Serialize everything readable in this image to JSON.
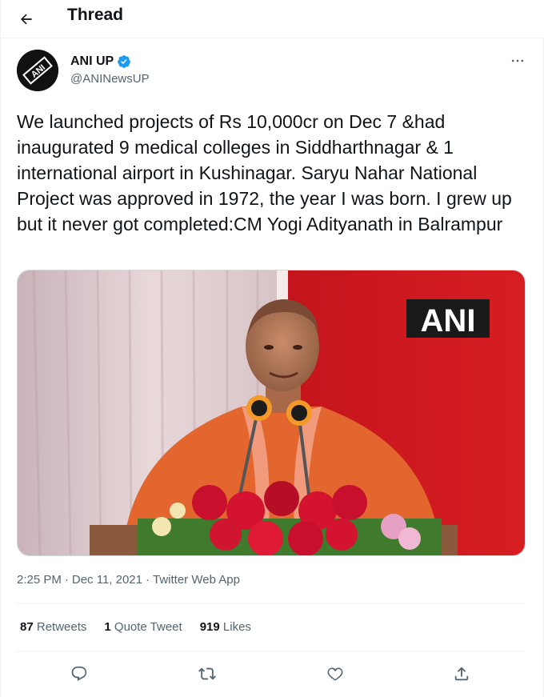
{
  "header": {
    "title": "Thread",
    "back_icon": "arrow-left-icon"
  },
  "author": {
    "name": "ANI UP",
    "handle": "@ANINewsUP",
    "verified": true,
    "avatar_text": "ANI"
  },
  "tweet": {
    "text": "We launched projects of Rs 10,000cr on Dec 7 &had inaugurated 9 medical colleges in Siddharthnagar & 1 international airport in Kushinagar. Saryu Nahar National Project was approved in 1972, the year I was born. I grew up but it never got completed:CM Yogi Adityanath in Balrampur",
    "media_watermark": "ANI"
  },
  "meta": {
    "time": "2:25 PM",
    "date": "Dec 11, 2021",
    "source": "Twitter Web App",
    "separator": "·"
  },
  "stats": {
    "retweets_count": "87",
    "retweets_label": "Retweets",
    "quotes_count": "1",
    "quotes_label": "Quote Tweet",
    "likes_count": "919",
    "likes_label": "Likes"
  },
  "actions": [
    "reply-icon",
    "retweet-icon",
    "like-icon",
    "share-icon"
  ],
  "colors": {
    "text": "#0f1419",
    "secondary": "#536471",
    "verified": "#1d9bf0",
    "divider": "#eff3f4"
  }
}
